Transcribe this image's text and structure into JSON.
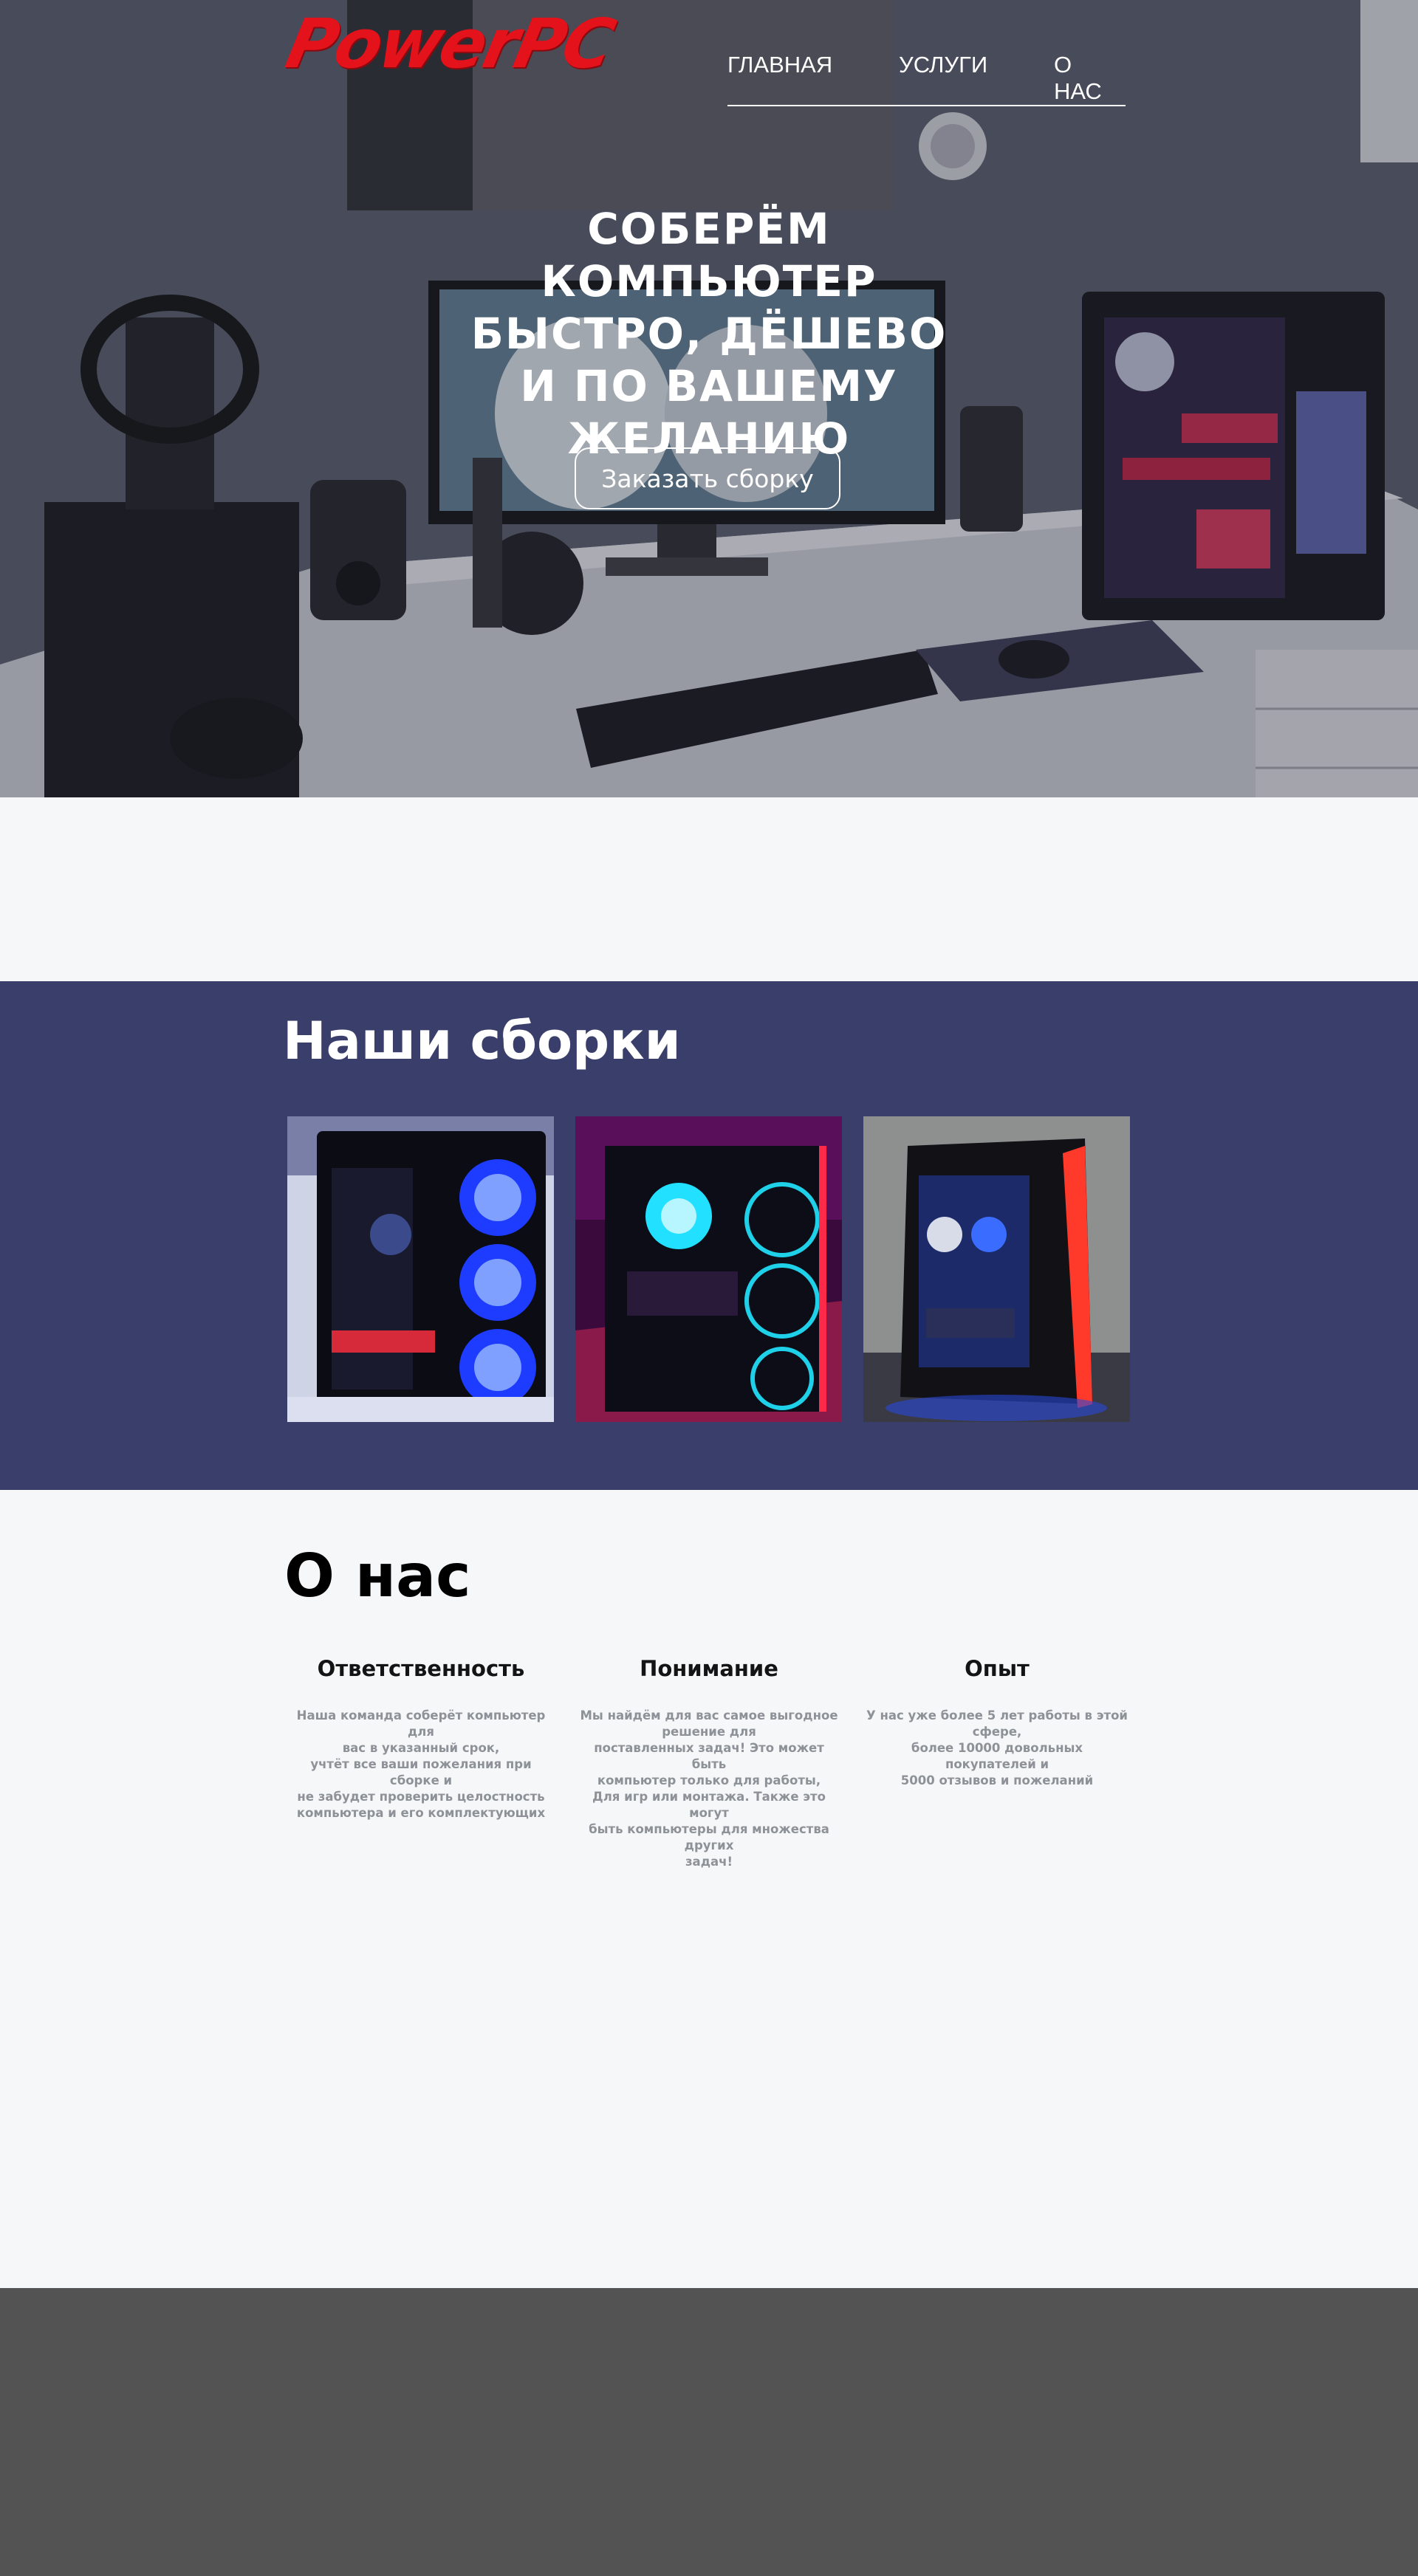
{
  "brand": {
    "logo_text": "PowerPC",
    "accent": "#e3121b"
  },
  "nav": {
    "items": [
      {
        "label": "ГЛАВНАЯ"
      },
      {
        "label": "УСЛУГИ"
      },
      {
        "label": "О НАС"
      }
    ]
  },
  "hero": {
    "title": "СОБЕРЁМ КОМПЬЮТЕР\nБЫСТРО, ДЁШЕВО\nИ ПО ВАШЕМУ\nЖЕЛАНИЮ",
    "button_label": "Заказать сборку"
  },
  "builds": {
    "title": "Наши сборки",
    "background": "#3a3e6b"
  },
  "about": {
    "title": "О нас",
    "columns": [
      {
        "heading": "Ответственность",
        "text": "Наша команда соберёт компьютер для\nвас в указанный срок,\nучтёт все ваши пожелания при сборке и\nне забудет проверить целостность\nкомпьютера и его комплектующих"
      },
      {
        "heading": "Понимание",
        "text": "Мы найдём для вас самое выгодное\nрешение для\nпоставленных задач! Это может быть\nкомпьютер только для работы,\nДля игр или монтажа. Также это могут\nбыть компьютеры для множества других\nзадач!"
      },
      {
        "heading": "Опыт",
        "text": "У нас уже более 5 лет работы в этой сфере,\nболее 10000 довольных покупателей и\n5000 отзывов и пожеланий"
      }
    ]
  },
  "footer": {
    "background": "#535353"
  }
}
